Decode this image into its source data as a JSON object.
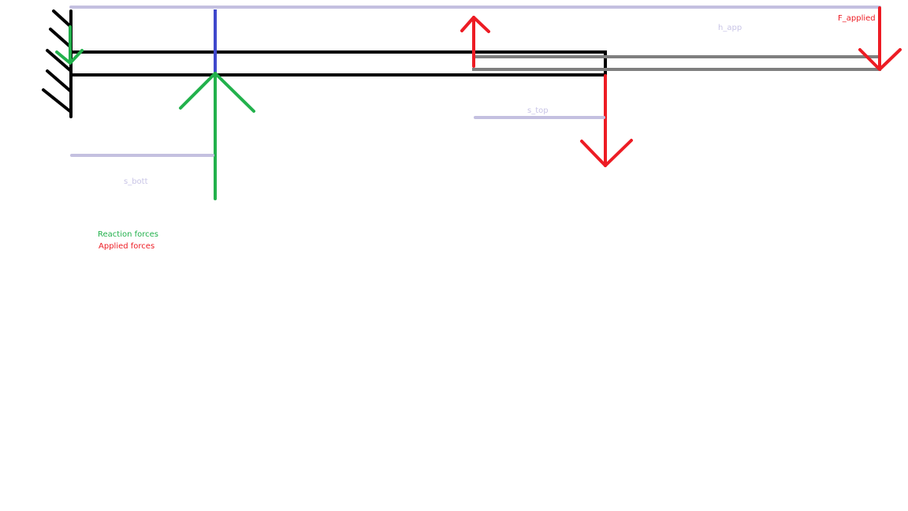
{
  "colors": {
    "structure": "#000000",
    "dimension": "#c4c0e0",
    "reaction": "#22b14c",
    "applied": "#ed1c24",
    "extension": "#7f7f7f",
    "guide": "#3f48cc",
    "dimension_text": "#c8c4e6"
  },
  "labels": {
    "f_applied": "F_applied",
    "h_app": "h_app",
    "s_top": "s_top",
    "s_bott": "s_bott"
  },
  "legend": {
    "reaction": "Reaction forces",
    "applied": "Applied forces"
  }
}
